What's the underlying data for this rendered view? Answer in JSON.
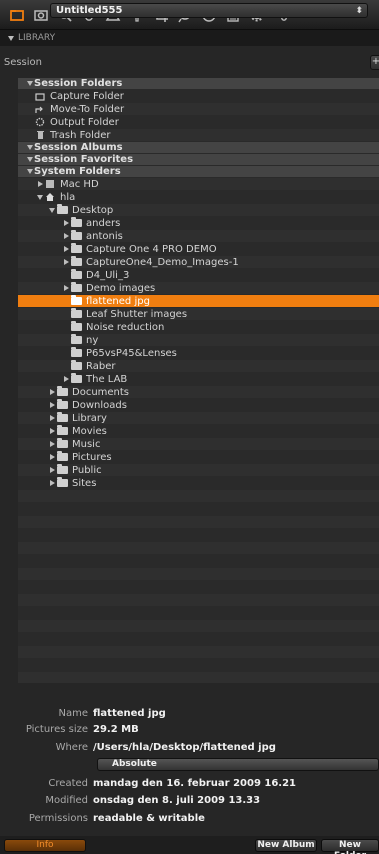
{
  "toolbar": {
    "icons": [
      "library-icon",
      "camera-icon",
      "search-icon",
      "color-icon",
      "exposure-icon",
      "focus-icon",
      "crop-icon",
      "lens-icon",
      "details-icon",
      "metadata-icon",
      "settings-icon",
      "adjustments-icon"
    ],
    "accent": "#f07e10"
  },
  "library": {
    "label": "LIBRARY"
  },
  "session": {
    "label": "Session",
    "value": "Untitled555",
    "stepper": "⬍",
    "plus": "+"
  },
  "tree": [
    {
      "type": "header",
      "label": "Session Folders",
      "disclosure": "down",
      "indent": 0
    },
    {
      "type": "item",
      "label": "Capture Folder",
      "icon": "capture-icon",
      "indent": 0
    },
    {
      "type": "item",
      "label": "Move-To Folder",
      "icon": "move-to-icon",
      "indent": 0
    },
    {
      "type": "item",
      "label": "Output Folder",
      "icon": "output-icon",
      "indent": 0
    },
    {
      "type": "item",
      "label": "Trash Folder",
      "icon": "trash-icon",
      "indent": 0
    },
    {
      "type": "header",
      "label": "Session Albums",
      "disclosure": "down",
      "indent": 0
    },
    {
      "type": "header",
      "label": "Session Favorites",
      "disclosure": "down",
      "indent": 0
    },
    {
      "type": "header",
      "label": "System Folders",
      "disclosure": "down",
      "indent": 0
    },
    {
      "type": "item",
      "label": "Mac HD",
      "icon": "drive-icon",
      "disclosure": "right",
      "indent": 1
    },
    {
      "type": "item",
      "label": "hla",
      "icon": "home-icon",
      "disclosure": "down",
      "indent": 1
    },
    {
      "type": "item",
      "label": "Desktop",
      "icon": "folder-icon",
      "disclosure": "down",
      "indent": 2
    },
    {
      "type": "item",
      "label": "anders",
      "icon": "folder-icon",
      "disclosure": "right",
      "indent": 3
    },
    {
      "type": "item",
      "label": "antonis",
      "icon": "folder-icon",
      "disclosure": "right",
      "indent": 3
    },
    {
      "type": "item",
      "label": "Capture One 4 PRO DEMO",
      "icon": "folder-icon",
      "disclosure": "right",
      "indent": 3
    },
    {
      "type": "item",
      "label": "CaptureOne4_Demo_Images-1",
      "icon": "folder-icon",
      "disclosure": "right",
      "indent": 3
    },
    {
      "type": "item",
      "label": "D4_Uli_3",
      "icon": "folder-icon",
      "indent": 3
    },
    {
      "type": "item",
      "label": "Demo images",
      "icon": "folder-icon",
      "disclosure": "right",
      "indent": 3
    },
    {
      "type": "item",
      "label": "flattened jpg",
      "icon": "folder-icon",
      "indent": 3,
      "selected": true
    },
    {
      "type": "item",
      "label": "Leaf Shutter images",
      "icon": "folder-icon",
      "indent": 3
    },
    {
      "type": "item",
      "label": "Noise reduction",
      "icon": "folder-icon",
      "indent": 3
    },
    {
      "type": "item",
      "label": "ny",
      "icon": "folder-icon",
      "indent": 3
    },
    {
      "type": "item",
      "label": "P65vsP45&Lenses",
      "icon": "folder-icon",
      "indent": 3
    },
    {
      "type": "item",
      "label": "Raber",
      "icon": "folder-icon",
      "indent": 3
    },
    {
      "type": "item",
      "label": "The LAB",
      "icon": "folder-icon",
      "disclosure": "right",
      "indent": 3
    },
    {
      "type": "item",
      "label": "Documents",
      "icon": "folder-icon",
      "disclosure": "right",
      "indent": 2
    },
    {
      "type": "item",
      "label": "Downloads",
      "icon": "folder-icon",
      "disclosure": "right",
      "indent": 2
    },
    {
      "type": "item",
      "label": "Library",
      "icon": "folder-icon",
      "disclosure": "right",
      "indent": 2
    },
    {
      "type": "item",
      "label": "Movies",
      "icon": "folder-icon",
      "disclosure": "right",
      "indent": 2
    },
    {
      "type": "item",
      "label": "Music",
      "icon": "folder-icon",
      "disclosure": "right",
      "indent": 2
    },
    {
      "type": "item",
      "label": "Pictures",
      "icon": "folder-icon",
      "disclosure": "right",
      "indent": 2
    },
    {
      "type": "item",
      "label": "Public",
      "icon": "folder-icon",
      "disclosure": "right",
      "indent": 2
    },
    {
      "type": "item",
      "label": "Sites",
      "icon": "folder-icon",
      "disclosure": "right",
      "indent": 2
    }
  ],
  "info": {
    "name_label": "Name",
    "name_value": "flattened jpg",
    "size_label": "Pictures size",
    "size_value": "29.2 MB",
    "where_label": "Where",
    "where_value": "/Users/hla/Desktop/flattened jpg",
    "path_mode": "Absolute",
    "created_label": "Created",
    "created_value": "mandag den 16. februar 2009 16.21",
    "modified_label": "Modified",
    "modified_value": "onsdag den 8. juli 2009 13.33",
    "permissions_label": "Permissions",
    "permissions_value": "readable & writable"
  },
  "buttons": {
    "info": "Info",
    "new_album": "New Album",
    "new_folder": "New Folder"
  }
}
